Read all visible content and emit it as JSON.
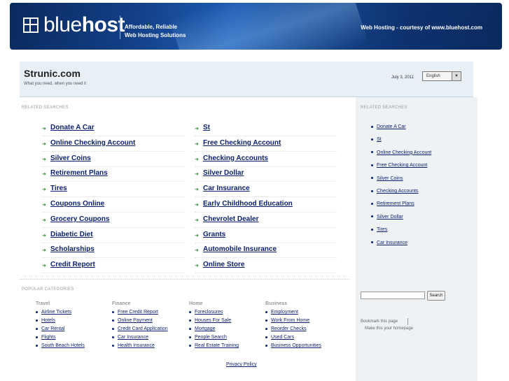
{
  "banner": {
    "logo_light": "blue",
    "logo_bold": "host",
    "tagline_line1": "Affordable, Reliable",
    "tagline_line2": "Web Hosting Solutions",
    "courtesy": "Web Hosting - courtesy of www.bluehost.com"
  },
  "header": {
    "title": "Strunic.com",
    "subtitle": "What you need, when you need it",
    "date": "July 3, 2011",
    "language": "English"
  },
  "related": {
    "label": "RELATED SEARCHES",
    "left": [
      "Donate A Car",
      "Online Checking Account",
      "Silver Coins",
      "Retirement Plans",
      "Tires",
      "Coupons Online",
      "Grocery Coupons",
      "Diabetic Diet",
      "Scholarships",
      "Credit Report"
    ],
    "right": [
      "St",
      "Free Checking Account",
      "Checking Accounts",
      "Silver Dollar",
      "Car Insurance",
      "Early Childhood Education",
      "Chevrolet Dealer",
      "Grants",
      "Automobile Insurance",
      "Online Store"
    ]
  },
  "sidebar": {
    "label": "RELATED SEARCHES",
    "items": [
      "Donate A Car",
      "St",
      "Online Checking Account",
      "Free Checking Account",
      "Silver Coins",
      "Checking Accounts",
      "Retirement Plans",
      "Silver Dollar",
      "Tires",
      "Car Insurance"
    ],
    "search_button": "Search",
    "bookmark": "Bookmark this page",
    "homepage": "Make this your homepage"
  },
  "popular": {
    "label": "POPULAR CATEGORIES",
    "columns": [
      {
        "title": "Travel",
        "items": [
          "Airline Tickets",
          "Hotels",
          "Car Rental",
          "Flights",
          "South Beach Hotels"
        ]
      },
      {
        "title": "Finance",
        "items": [
          "Free Credit Report",
          "Online Payment",
          "Credit Card Application",
          "Car Insurance",
          "Health Insurance"
        ]
      },
      {
        "title": "Home",
        "items": [
          "Foreclosures",
          "Houses For Sale",
          "Mortgage",
          "People Search",
          "Real Estate Training"
        ]
      },
      {
        "title": "Business",
        "items": [
          "Employment",
          "Work From Home",
          "Reorder Checks",
          "Used Cars",
          "Business Opportunities"
        ]
      }
    ]
  },
  "footer": {
    "privacy": "Privacy Policy"
  },
  "colors": {
    "link": "#0a1f6b",
    "arrow": "#2a8a2a",
    "banner": "#133f86"
  }
}
